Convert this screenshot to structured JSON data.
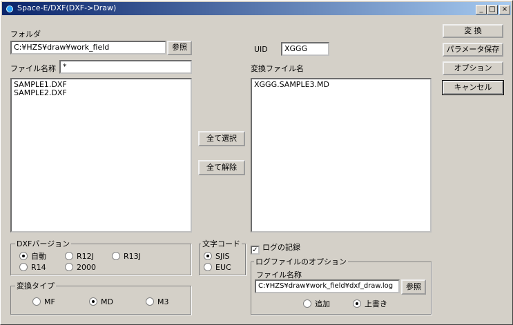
{
  "window": {
    "title": "Space-E/DXF(DXF->Draw)"
  },
  "folder": {
    "label": "フォルダ",
    "value": "C:¥HZS¥draw¥work_field",
    "browse": "参照"
  },
  "file_name": {
    "label": "ファイル名称",
    "value": "*"
  },
  "source_files": [
    "SAMPLE1.DXF",
    "SAMPLE2.DXF"
  ],
  "uid": {
    "label": "UID",
    "value": "XGGG"
  },
  "converted": {
    "label": "変換ファイル名",
    "files": [
      "XGGG.SAMPLE3.MD"
    ]
  },
  "middle": {
    "select_all": "全て選択",
    "deselect_all": "全て解除"
  },
  "buttons": {
    "convert": "変 換",
    "save_params": "パラメータ保存",
    "options": "オプション",
    "cancel": "キャンセル"
  },
  "dxf_version": {
    "label": "DXFバージョン",
    "options": [
      "自動",
      "R12J",
      "R13J",
      "R14",
      "2000"
    ],
    "selected": "自動"
  },
  "char_code": {
    "label": "文字コード",
    "options": [
      "SJIS",
      "EUC"
    ],
    "selected": "SJIS"
  },
  "conv_type": {
    "label": "変換タイプ",
    "options": [
      "MF",
      "MD",
      "M3"
    ],
    "selected": "MD"
  },
  "log": {
    "record_label": "ログの記録",
    "record_checked": true,
    "group_label": "ログファイルのオプション",
    "file_label": "ファイル名称",
    "file_value": "C:¥HZS¥draw¥work_field¥dxf_draw.log",
    "browse": "参照",
    "mode_options": [
      "追加",
      "上書き"
    ],
    "mode_selected": "上書き"
  }
}
